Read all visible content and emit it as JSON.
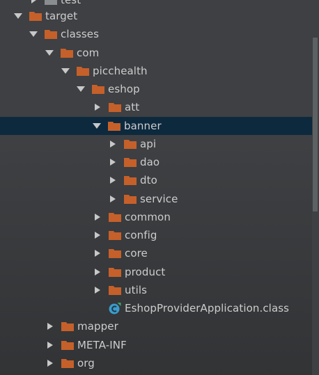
{
  "tree": {
    "items": [
      {
        "label": "test",
        "expanded": false,
        "icon": "folder-icon"
      },
      {
        "label": "target",
        "expanded": true,
        "icon": "folder-icon"
      },
      {
        "label": "classes",
        "expanded": true,
        "icon": "folder-icon"
      },
      {
        "label": "com",
        "expanded": true,
        "icon": "folder-icon"
      },
      {
        "label": "picchealth",
        "expanded": true,
        "icon": "folder-icon"
      },
      {
        "label": "eshop",
        "expanded": true,
        "icon": "folder-icon"
      },
      {
        "label": "att",
        "expanded": false,
        "icon": "folder-icon"
      },
      {
        "label": "banner",
        "expanded": true,
        "selected": true,
        "icon": "folder-icon"
      },
      {
        "label": "api",
        "expanded": false,
        "icon": "folder-icon"
      },
      {
        "label": "dao",
        "expanded": false,
        "icon": "folder-icon"
      },
      {
        "label": "dto",
        "expanded": false,
        "icon": "folder-icon"
      },
      {
        "label": "service",
        "expanded": false,
        "icon": "folder-icon"
      },
      {
        "label": "common",
        "expanded": false,
        "icon": "folder-icon"
      },
      {
        "label": "config",
        "expanded": false,
        "icon": "folder-icon"
      },
      {
        "label": "core",
        "expanded": false,
        "icon": "folder-icon"
      },
      {
        "label": "product",
        "expanded": false,
        "icon": "folder-icon"
      },
      {
        "label": "utils",
        "expanded": false,
        "icon": "folder-icon"
      },
      {
        "label": "EshopProviderApplication.class",
        "icon": "class-file-icon"
      },
      {
        "label": "mapper",
        "expanded": false,
        "icon": "folder-icon"
      },
      {
        "label": "META-INF",
        "expanded": false,
        "icon": "folder-icon"
      },
      {
        "label": "org",
        "expanded": false,
        "icon": "folder-icon"
      }
    ]
  },
  "colors": {
    "background": "#3e4043",
    "selection": "#0d293e",
    "folder": "#c5602a",
    "folder_muted": "#8a8d90",
    "text": "#cdcdcd",
    "arrow": "#c8c8c8",
    "class_icon": "#3c9ccb"
  }
}
